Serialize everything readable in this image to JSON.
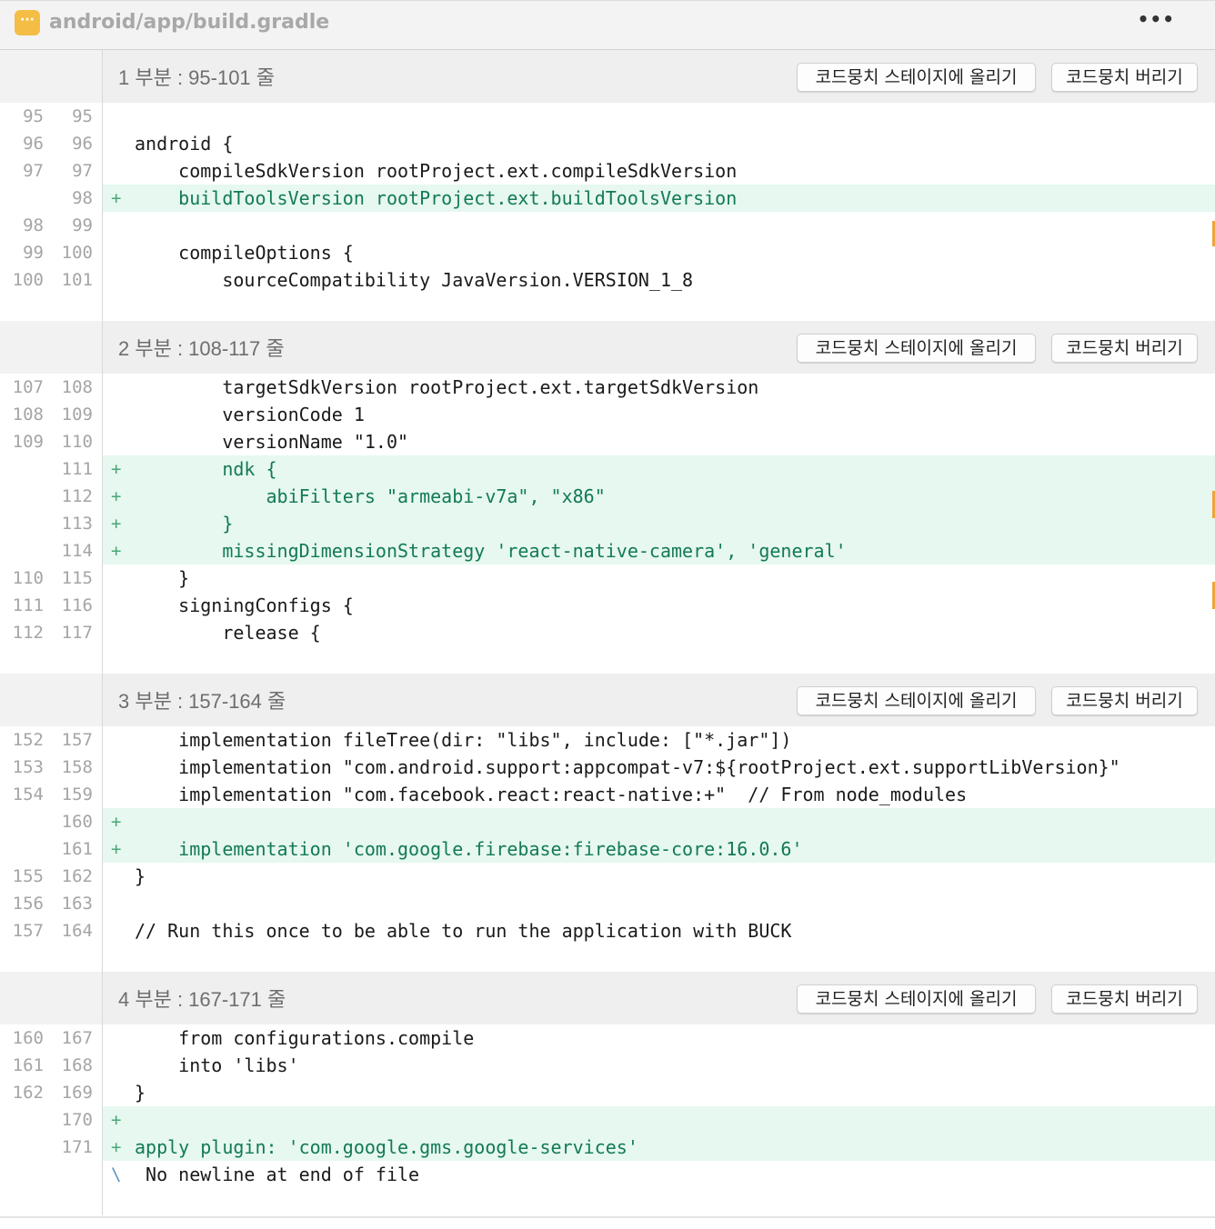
{
  "file": {
    "path": "android/app/build.gradle",
    "icon": "ellipsis-file-icon",
    "icon_glyph": "···",
    "menu_glyph": "•••",
    "accent": "#f4bd45"
  },
  "buttons": {
    "stage": "코드뭉치 스테이지에 올리기",
    "discard": "코드뭉치 버리기"
  },
  "hunks": [
    {
      "title": "1 부분 : 95-101 줄",
      "lines": [
        {
          "old": "95",
          "new": "95",
          "type": "ctx",
          "code": ""
        },
        {
          "old": "96",
          "new": "96",
          "type": "ctx",
          "code": "android {"
        },
        {
          "old": "97",
          "new": "97",
          "type": "ctx",
          "code": "    compileSdkVersion rootProject.ext.compileSdkVersion"
        },
        {
          "old": "",
          "new": "98",
          "type": "add",
          "code": "    buildToolsVersion rootProject.ext.buildToolsVersion"
        },
        {
          "old": "98",
          "new": "99",
          "type": "ctx",
          "code": ""
        },
        {
          "old": "99",
          "new": "100",
          "type": "ctx",
          "code": "    compileOptions {"
        },
        {
          "old": "100",
          "new": "101",
          "type": "ctx",
          "code": "        sourceCompatibility JavaVersion.VERSION_1_8"
        }
      ]
    },
    {
      "title": "2 부분 : 108-117 줄",
      "lines": [
        {
          "old": "107",
          "new": "108",
          "type": "ctx",
          "code": "        targetSdkVersion rootProject.ext.targetSdkVersion"
        },
        {
          "old": "108",
          "new": "109",
          "type": "ctx",
          "code": "        versionCode 1"
        },
        {
          "old": "109",
          "new": "110",
          "type": "ctx",
          "code": "        versionName \"1.0\""
        },
        {
          "old": "",
          "new": "111",
          "type": "add",
          "code": "        ndk {"
        },
        {
          "old": "",
          "new": "112",
          "type": "add",
          "code": "            abiFilters \"armeabi-v7a\", \"x86\""
        },
        {
          "old": "",
          "new": "113",
          "type": "add",
          "code": "        }"
        },
        {
          "old": "",
          "new": "114",
          "type": "add",
          "code": "        missingDimensionStrategy 'react-native-camera', 'general'"
        },
        {
          "old": "110",
          "new": "115",
          "type": "ctx",
          "code": "    }"
        },
        {
          "old": "111",
          "new": "116",
          "type": "ctx",
          "code": "    signingConfigs {"
        },
        {
          "old": "112",
          "new": "117",
          "type": "ctx",
          "code": "        release {"
        }
      ]
    },
    {
      "title": "3 부분 : 157-164 줄",
      "lines": [
        {
          "old": "152",
          "new": "157",
          "type": "ctx",
          "code": "    implementation fileTree(dir: \"libs\", include: [\"*.jar\"])"
        },
        {
          "old": "153",
          "new": "158",
          "type": "ctx",
          "code": "    implementation \"com.android.support:appcompat-v7:${rootProject.ext.supportLibVersion}\""
        },
        {
          "old": "154",
          "new": "159",
          "type": "ctx",
          "code": "    implementation \"com.facebook.react:react-native:+\"  // From node_modules"
        },
        {
          "old": "",
          "new": "160",
          "type": "add",
          "code": ""
        },
        {
          "old": "",
          "new": "161",
          "type": "add",
          "code": "    implementation 'com.google.firebase:firebase-core:16.0.6'"
        },
        {
          "old": "155",
          "new": "162",
          "type": "ctx",
          "code": "}"
        },
        {
          "old": "156",
          "new": "163",
          "type": "ctx",
          "code": ""
        },
        {
          "old": "157",
          "new": "164",
          "type": "ctx",
          "code": "// Run this once to be able to run the application with BUCK"
        }
      ]
    },
    {
      "title": "4 부분 : 167-171 줄",
      "lines": [
        {
          "old": "160",
          "new": "167",
          "type": "ctx",
          "code": "    from configurations.compile"
        },
        {
          "old": "161",
          "new": "168",
          "type": "ctx",
          "code": "    into 'libs'"
        },
        {
          "old": "162",
          "new": "169",
          "type": "ctx",
          "code": "}"
        },
        {
          "old": "",
          "new": "170",
          "type": "add",
          "code": ""
        },
        {
          "old": "",
          "new": "171",
          "type": "add",
          "code": "apply plugin: 'com.google.gms.google-services'"
        },
        {
          "old": "",
          "new": "",
          "type": "meta",
          "code": " No newline at end of file"
        }
      ]
    }
  ],
  "markers": {
    "add": "+",
    "meta": "\\"
  },
  "colors": {
    "add_bg": "#e6f8ef",
    "add_text": "#137a55",
    "hunk_header_bg": "#efefef",
    "scroll_mark": "#f0a33a"
  }
}
